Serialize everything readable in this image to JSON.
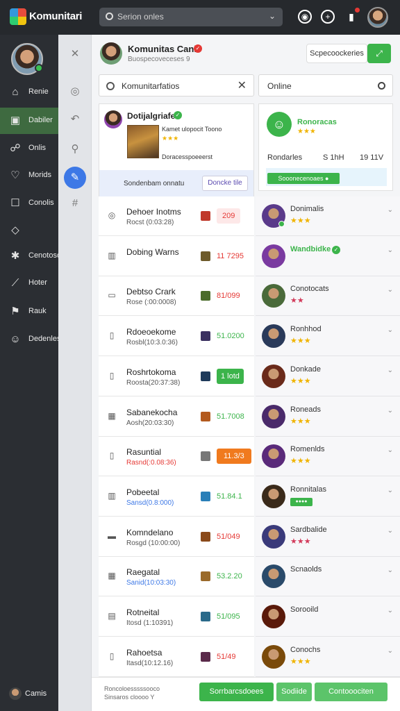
{
  "app": {
    "name": "Komunitari"
  },
  "topbar": {
    "search_placeholder": "Serion onles"
  },
  "sidebar": {
    "items": [
      {
        "label": "Renie",
        "icon": "home-icon",
        "active": false
      },
      {
        "label": "Dabiler",
        "icon": "chat-icon",
        "active": true
      },
      {
        "label": "Onlis",
        "icon": "people-icon",
        "active": false
      },
      {
        "label": "Morids",
        "icon": "heart-icon",
        "active": false
      },
      {
        "label": "Conolis",
        "icon": "square-icon",
        "active": false
      },
      {
        "label": "",
        "icon": "cube-icon",
        "active": false
      },
      {
        "label": "Cenotoso",
        "icon": "puzzle-icon",
        "active": false
      },
      {
        "label": "Hoter",
        "icon": "sword-icon",
        "active": false
      },
      {
        "label": "Rauk",
        "icon": "flag-icon",
        "active": false
      },
      {
        "label": "Dedenles",
        "icon": "avatar-icon",
        "active": false
      }
    ],
    "footer_label": "Camis"
  },
  "header": {
    "title": "Komunitas Canle",
    "subtitle": "Buospecoveceses 9",
    "button_label": "Scpecoockeries"
  },
  "search_main": {
    "value": "Komunitarfatios"
  },
  "search_side": {
    "value": "Online"
  },
  "feature": {
    "title": "Dotijalgriafe",
    "line1": "Kamet ulopocit Toono",
    "stars": "★★★",
    "line2": "Doracesspoeeerst",
    "band_label": "Sondenbam onnatu",
    "band_button": "Doncke tile"
  },
  "side_card": {
    "title": "Ronoracas",
    "stars": "★★★",
    "label": "Rondarles",
    "value1": "S 1hH",
    "value2": "19 11V",
    "button": "Sooonecenoaes ●"
  },
  "list_left": [
    {
      "icon": "target-icon",
      "title": "Dehoer Inotms",
      "sub": "Rocst (0:03:28)",
      "sub_style": "",
      "thumb": "#c0392b",
      "value": "209",
      "value_style": "pillpink"
    },
    {
      "icon": "chart-icon",
      "title": "Dobing Warns",
      "sub": "",
      "sub_style": "",
      "thumb": "#6d5a2a",
      "value": "11 7295",
      "value_style": "red"
    },
    {
      "icon": "message-icon",
      "title": "Debtso Crark",
      "sub": "Rose (:00:0008)",
      "sub_style": "",
      "thumb": "#4a6b2a",
      "value": "81/099",
      "value_style": "red"
    },
    {
      "icon": "doc-icon",
      "title": "Rdoeoekome",
      "sub": "Rosbl(10:3.0:36)",
      "sub_style": "",
      "thumb": "#3a3060",
      "value": "51.0200",
      "value_style": "green"
    },
    {
      "icon": "doc-icon",
      "title": "Roshrtokoma",
      "sub": "Roosta(20:37:38)",
      "sub_style": "",
      "thumb": "#1e3a5a",
      "value": "1 lotd",
      "value_style": "pillgreen"
    },
    {
      "icon": "calendar-icon",
      "title": "Sabanekocha",
      "sub": "Aosh(20:03:30)",
      "sub_style": "",
      "thumb": "#b35a1e",
      "value": "51.7008",
      "value_style": "green"
    },
    {
      "icon": "doc-icon",
      "title": "Rasuntial",
      "sub": "Rasnd(:0.08:36)",
      "sub_style": "red",
      "thumb": "#777777",
      "value": "11.3/3",
      "value_style": "pillorange"
    },
    {
      "icon": "chart-icon",
      "title": "Pobeetal",
      "sub": "Sansd(0.8:000)",
      "sub_style": "blue",
      "thumb": "#2a7fb8",
      "value": "51.84.1",
      "value_style": "green"
    },
    {
      "icon": "card-icon",
      "title": "Komndelano",
      "sub": "Rosgd (10:00:00)",
      "sub_style": "",
      "thumb": "#8a4a1a",
      "value": "51/049",
      "value_style": "red"
    },
    {
      "icon": "calendar-icon",
      "title": "Raegatal",
      "sub": "Sanid(10:03:30)",
      "sub_style": "blue",
      "thumb": "#9a6a2a",
      "value": "53.2.20",
      "value_style": "green"
    },
    {
      "icon": "image-icon",
      "title": "Rotneital",
      "sub": "Itosd (1:10391)",
      "sub_style": "",
      "thumb": "#2a6a8a",
      "value": "51/095",
      "value_style": "green"
    },
    {
      "icon": "doc-icon",
      "title": "Rahoetsa",
      "sub": "Itasd(10:12.16)",
      "sub_style": "",
      "thumb": "#5a2a4a",
      "value": "51/49",
      "value_style": "red"
    }
  ],
  "list_right": [
    {
      "title": "Donimalis",
      "title_style": "",
      "verified": false,
      "online": true,
      "rating": "★★★",
      "rating_style": "",
      "tag": "",
      "avatar": "#5a3a8a"
    },
    {
      "title": "Wandbidke",
      "title_style": "green",
      "verified": true,
      "online": false,
      "rating": "",
      "rating_style": "",
      "tag": "",
      "avatar": "#7a3aa0"
    },
    {
      "title": "Conotocats",
      "title_style": "",
      "verified": false,
      "online": false,
      "rating": "★★",
      "rating_style": "mixed",
      "tag": "",
      "avatar": "#4a6a3a"
    },
    {
      "title": "Ronhhod",
      "title_style": "",
      "verified": false,
      "online": false,
      "rating": "★★★",
      "rating_style": "",
      "tag": "",
      "avatar": "#2a3a5a"
    },
    {
      "title": "Donkade",
      "title_style": "",
      "verified": false,
      "online": false,
      "rating": "★★★",
      "rating_style": "",
      "tag": "",
      "avatar": "#6a2a1a"
    },
    {
      "title": "Roneads",
      "title_style": "",
      "verified": false,
      "online": false,
      "rating": "★★★",
      "rating_style": "",
      "tag": "",
      "avatar": "#4a2a6a"
    },
    {
      "title": "Romenlds",
      "title_style": "",
      "verified": false,
      "online": false,
      "rating": "★★★",
      "rating_style": "",
      "tag": "",
      "avatar": "#5a2a7a"
    },
    {
      "title": "Ronnitalas",
      "title_style": "",
      "verified": false,
      "online": false,
      "rating": "",
      "rating_style": "",
      "tag": "●●●●",
      "avatar": "#3a2a1a"
    },
    {
      "title": "Sardbalide",
      "title_style": "",
      "verified": false,
      "online": false,
      "rating": "★★★",
      "rating_style": "mixed",
      "tag": "",
      "avatar": "#3a3a7a"
    },
    {
      "title": "Scnaolds",
      "title_style": "",
      "verified": false,
      "online": false,
      "rating": "",
      "rating_style": "",
      "tag": "",
      "avatar": "#2a4a6a"
    },
    {
      "title": "Sorooild",
      "title_style": "",
      "verified": false,
      "online": false,
      "rating": "",
      "rating_style": "",
      "tag": "",
      "avatar": "#5a1a0a"
    },
    {
      "title": "Conochs",
      "title_style": "",
      "verified": false,
      "online": false,
      "rating": "★★★",
      "rating_style": "",
      "tag": "",
      "avatar": "#7a4a0a"
    }
  ],
  "footer": {
    "line1": "Roncoloesssssooco",
    "line2": "Sinsaros cloooo Y",
    "btn1": "Sorrbarcsdoees",
    "btn2": "Sodiide",
    "btn3": "Contooociten"
  },
  "colors": {
    "accent": "#3cb44b",
    "sidebar_bg": "#2b2e33",
    "topbar_bg": "#26292d",
    "blue": "#3d78e6"
  }
}
